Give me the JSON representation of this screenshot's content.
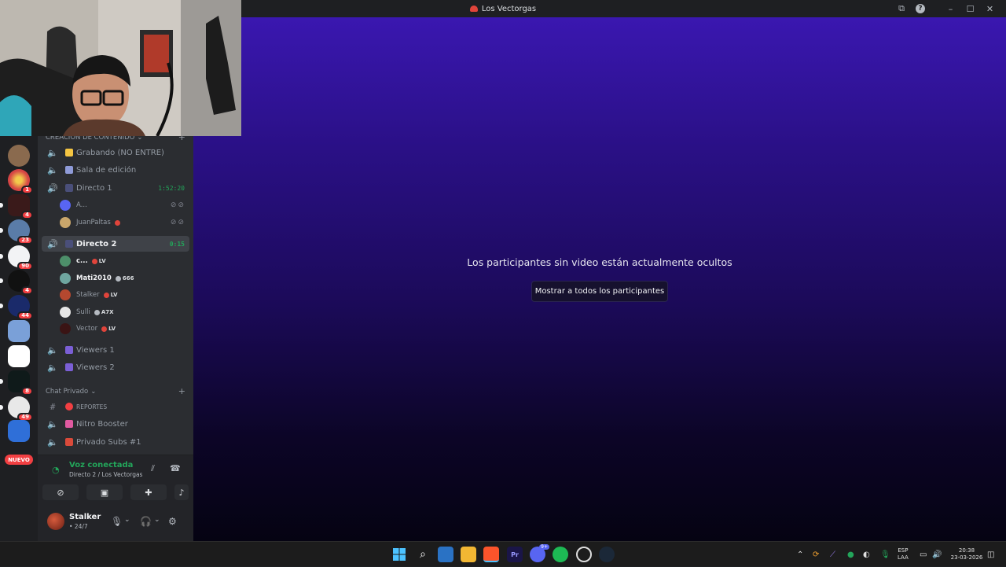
{
  "window": {
    "title": "Los Vectorgas",
    "help_label": "?",
    "minimize": "–",
    "maximize": "☐",
    "close": "✕",
    "inbox_icon": "⧉"
  },
  "server_rail": {
    "badges": [
      "1",
      "4",
      "23",
      "90",
      "4",
      "44",
      "8",
      "49"
    ],
    "nuevo_label": "NUEVO"
  },
  "categories": {
    "content": "CREACIÓN DE CONTENIDO",
    "private": "Chat Privado"
  },
  "channels": {
    "grabando": "Grabando (NO ENTRE)",
    "sala": "Sala de edición",
    "directo1": "Directo 1",
    "directo1_time": "1:52:20",
    "directo2": "Directo 2",
    "directo2_time": "0:15",
    "viewers1": "Viewers 1",
    "viewers2": "Viewers 2",
    "reportes": "REPORTES",
    "nitro": "Nitro Booster",
    "privado_subs": "Privado Subs #1"
  },
  "directo1_users": [
    {
      "name": "A..."
    },
    {
      "name": "JuanPaltas"
    }
  ],
  "directo2_users": [
    {
      "name": "c...",
      "tag": "LV"
    },
    {
      "name": "Mati2010",
      "tag": "666"
    },
    {
      "name": "Stalker",
      "tag": "LV"
    },
    {
      "name": "Sulli",
      "tag": "A7X"
    },
    {
      "name": "Vector",
      "tag": "LV"
    }
  ],
  "voice": {
    "status": "Voz conectada",
    "location": "Directo 2 / Los Vectorgas"
  },
  "user": {
    "name": "Stalker",
    "status": "• 24/7"
  },
  "stage": {
    "message": "Los participantes sin video están actualmente ocultos",
    "button": "Mostrar a todos los participantes"
  },
  "tray": {
    "lang_top": "ESP",
    "lang_bottom": "LAA",
    "time": "20:38",
    "date": "23-03-2026",
    "chevron": "⌃",
    "discord_badge": "9+"
  },
  "colors": {
    "accent_green": "#23a55a",
    "badge_red": "#f23f42",
    "stage_top": "#3a17b0",
    "stage_bottom": "#050312"
  }
}
